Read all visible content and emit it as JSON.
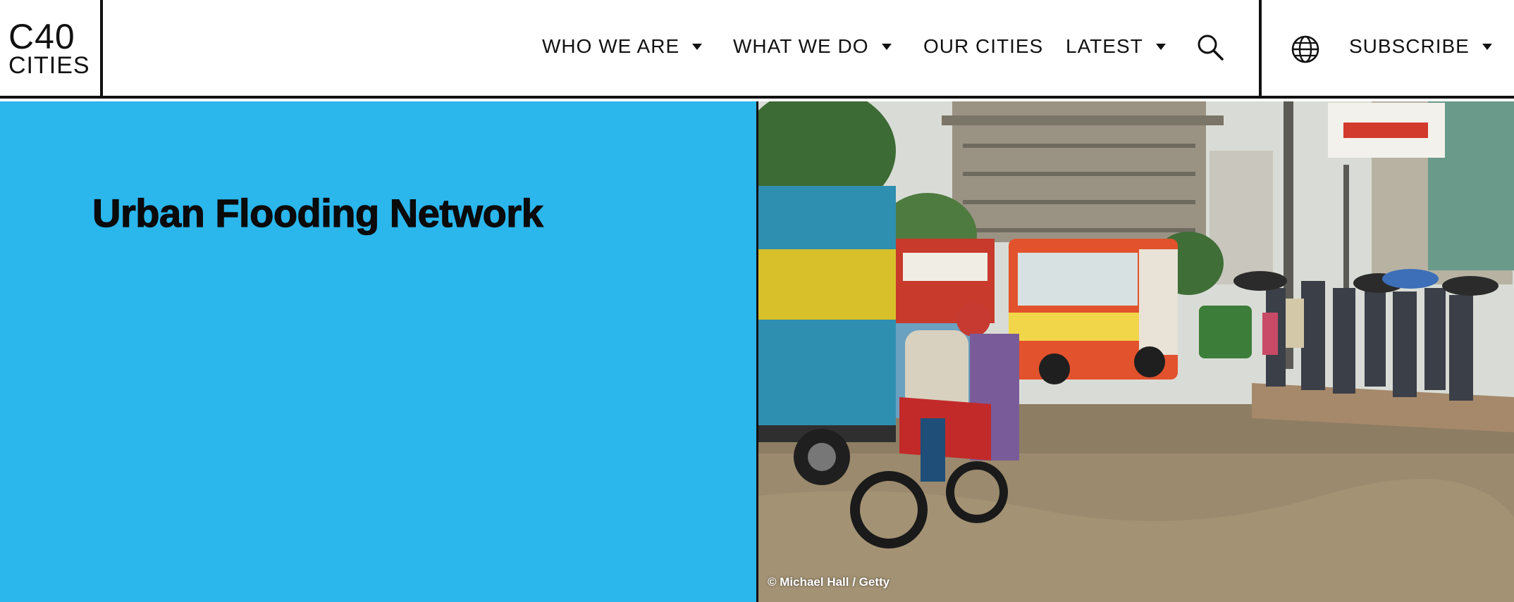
{
  "logo": {
    "line1": "C40",
    "line2": "CITIES"
  },
  "nav": {
    "items": [
      {
        "label": "WHO WE ARE",
        "has_dropdown": true
      },
      {
        "label": "WHAT WE DO",
        "has_dropdown": true
      },
      {
        "label": "OUR CITIES",
        "has_dropdown": false
      },
      {
        "label": "LATEST",
        "has_dropdown": true
      }
    ],
    "search_icon": "search-icon",
    "language_icon": "globe-icon",
    "subscribe_label": "SUBSCRIBE"
  },
  "hero": {
    "title": "Urban Flooding Network",
    "background_color": "#2bb6ec",
    "image_credit": "© Michael Hall / Getty"
  }
}
